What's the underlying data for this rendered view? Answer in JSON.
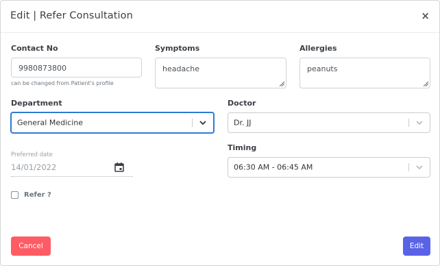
{
  "modal": {
    "title": "Edit | Refer Consultation",
    "close_glyph": "×"
  },
  "contact": {
    "label": "Contact No",
    "value": "9980873800",
    "help": "can be changed from Patient's profile"
  },
  "symptoms": {
    "label": "Symptoms",
    "value": "headache"
  },
  "allergies": {
    "label": "Allergies",
    "value": "peanuts"
  },
  "department": {
    "label": "Department",
    "selected": "General Medicine"
  },
  "doctor": {
    "label": "Doctor",
    "selected": "Dr. JJ"
  },
  "preferred_date": {
    "label": "Preferred date",
    "value": "14/01/2022",
    "icon": "calendar-icon"
  },
  "timing": {
    "label": "Timing",
    "selected": "06:30 AM - 06:45 AM"
  },
  "refer": {
    "label": "Refer ?",
    "checked": false
  },
  "footer": {
    "cancel_label": "Cancel",
    "edit_label": "Edit"
  },
  "colors": {
    "cancel": "#ff5b65",
    "edit": "#5a63e6",
    "focus_border": "#2d7ad6"
  }
}
